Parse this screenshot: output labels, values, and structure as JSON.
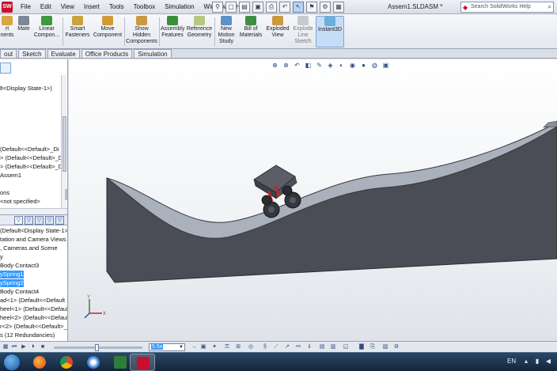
{
  "menubar": {
    "items": [
      "File",
      "Edit",
      "View",
      "Insert",
      "Tools",
      "Toolbox",
      "Simulation",
      "Window",
      "Help"
    ]
  },
  "window": {
    "document_title": "Assem1.SLDASM *"
  },
  "help_search": {
    "placeholder": "Search SolidWorks Help"
  },
  "ribbon": {
    "buttons": [
      {
        "label": "rt\nnents"
      },
      {
        "label": "Mate"
      },
      {
        "label": "Linear\nCompon..."
      },
      {
        "label": "Smart\nFasteners"
      },
      {
        "label": "Move\nComponent"
      },
      {
        "label": "Show\nHidden\nComponents"
      },
      {
        "label": "Assembly\nFeatures"
      },
      {
        "label": "Reference\nGeometry"
      },
      {
        "label": "New\nMotion\nStudy"
      },
      {
        "label": "Bill of\nMaterials"
      },
      {
        "label": "Exploded\nView"
      },
      {
        "label": "Explode\nLine\nSketch"
      },
      {
        "label": "Instant3D"
      }
    ]
  },
  "tabs": [
    "out",
    "Sketch",
    "Evaluate",
    "Office Products",
    "Simulation"
  ],
  "config_tree": {
    "rows": [
      "lt<Display State-1>)",
      "(Default<<Default>_Di",
      "> (Default<<Default>_D",
      "> (Default<<Default>_D",
      "Assem1",
      "ons",
      "<not specified>"
    ]
  },
  "motion_tree": {
    "rows": [
      "(Default<Display State-1>)",
      "tation and Camera Views",
      ", Cameras and Scene",
      "y",
      "Body Contact3",
      "ySpring1",
      "ySpring2",
      "Body Contact4",
      "ad<1> (Default<<Default",
      "heel<1> (Default<<Default",
      "heel<2> (Default<<Default",
      "r<2> (Default<<Default>_",
      "s (12 Redundancies)"
    ],
    "selected": [
      5,
      6
    ]
  },
  "timeline": {
    "speed_value": "5.5x"
  },
  "tray": {
    "language": "EN"
  },
  "colors": {
    "track_top": "#aab0bc",
    "track_side": "#4a4d55",
    "selection": "#3399ff",
    "taskbar": "#1c3350"
  },
  "axis": {
    "x_label": "X",
    "y_label": "Y"
  }
}
